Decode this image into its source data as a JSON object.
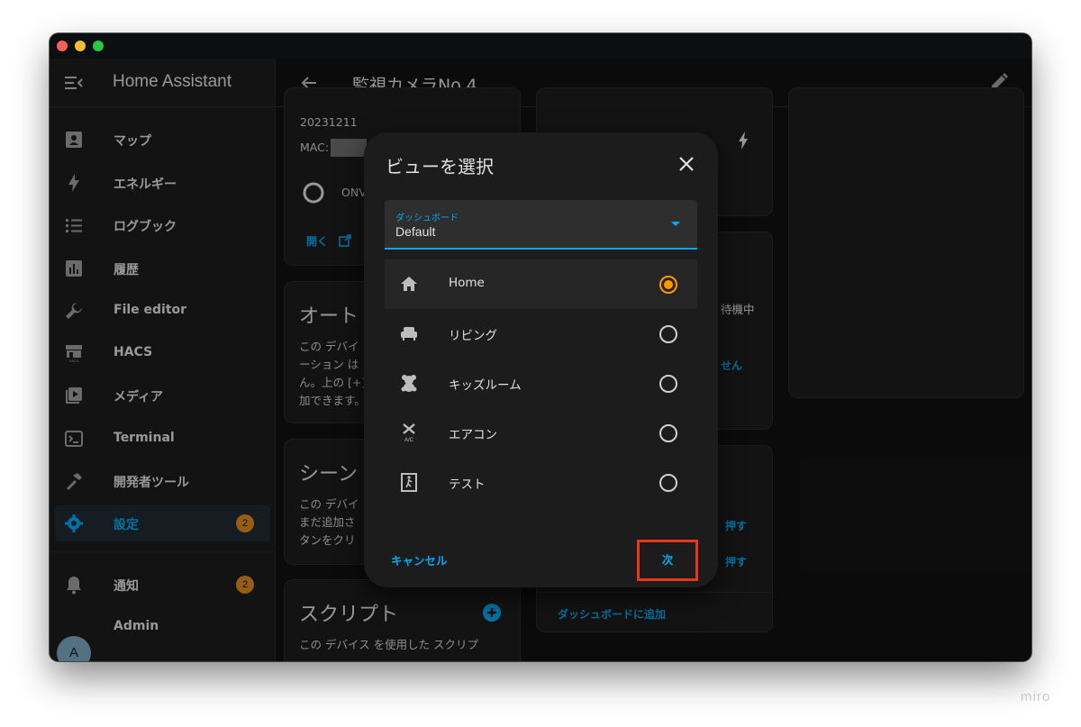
{
  "app": {
    "title": "Home Assistant"
  },
  "page": {
    "title": "監視カメラNo.4"
  },
  "sidebar": {
    "items": [
      {
        "label": "マップ",
        "icon": "map-icon"
      },
      {
        "label": "エネルギー",
        "icon": "energy-icon"
      },
      {
        "label": "ログブック",
        "icon": "logbook-icon"
      },
      {
        "label": "履歴",
        "icon": "history-icon"
      },
      {
        "label": "File editor",
        "icon": "wrench-icon"
      },
      {
        "label": "HACS",
        "icon": "hacs-icon"
      },
      {
        "label": "メディア",
        "icon": "media-icon"
      },
      {
        "label": "Terminal",
        "icon": "terminal-icon"
      },
      {
        "label": "開発者ツール",
        "icon": "hammer-icon"
      },
      {
        "label": "設定",
        "icon": "gear-icon",
        "badge": "2",
        "active": true
      }
    ],
    "notifications": {
      "label": "通知",
      "badge": "2"
    },
    "user": {
      "label": "Admin",
      "initial": "A"
    }
  },
  "background": {
    "info_card": {
      "date": "20231211",
      "mac_label": "MAC:",
      "integration": "ONV",
      "open_link": "開く"
    },
    "automation_card": {
      "title": "オート",
      "text": [
        "この デバイ",
        "ーション は",
        "ん。上の [+]",
        "加できます。"
      ]
    },
    "scene_card": {
      "title": "シーン",
      "text": [
        "この デバイ",
        "まだ追加さ",
        "タンをクリ"
      ]
    },
    "script_card": {
      "title": "スクリプト",
      "text": [
        "この デバイス を使用した スクリプ"
      ]
    },
    "status_card": {
      "status": "待機中",
      "link": "せん"
    },
    "button_card": {
      "press1": "押す",
      "press2": "押す",
      "add_to_dashboard": "ダッシュボードに追加"
    }
  },
  "dialog": {
    "title": "ビューを選択",
    "select": {
      "label": "ダッシュボード",
      "value": "Default"
    },
    "options": [
      {
        "label": "Home",
        "icon": "home-icon",
        "selected": true
      },
      {
        "label": "リビング",
        "icon": "sofa-icon",
        "selected": false
      },
      {
        "label": "キッズルーム",
        "icon": "teddy-bear-icon",
        "selected": false
      },
      {
        "label": "エアコン",
        "icon": "air-conditioner-icon",
        "selected": false
      },
      {
        "label": "テスト",
        "icon": "door-exit-icon",
        "selected": false
      }
    ],
    "cancel": "キャンセル",
    "next": "次"
  },
  "watermark": "miro",
  "colors": {
    "accent": "#03a9f4",
    "radio_selected": "#ff9800",
    "badge": "#e08a1e",
    "highlight_box": "#e8361b"
  }
}
